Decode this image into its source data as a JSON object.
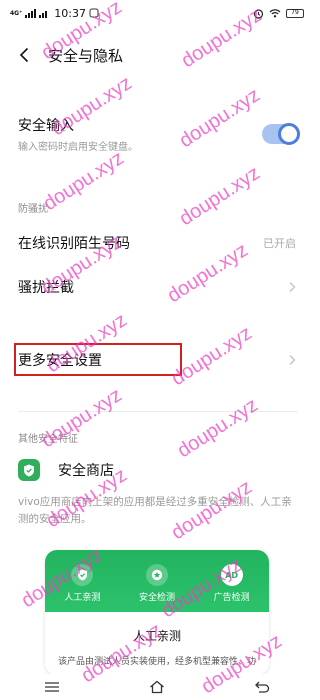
{
  "status_bar": {
    "network": "4G⁺",
    "time": "10:37",
    "battery": "79"
  },
  "header": {
    "title": "安全与隐私"
  },
  "rows": {
    "secure_input": {
      "title": "安全输入",
      "subtitle": "输入密码时启用安全键盘。",
      "toggle_on": true
    },
    "section_anti_harass": "防骚扰",
    "stranger_id": {
      "title": "在线识别陌生号码",
      "status": "已开启"
    },
    "harass_block": {
      "title": "骚扰拦截"
    },
    "more_security": {
      "title": "更多安全设置"
    }
  },
  "other_features": {
    "label": "其他安全特征",
    "store": {
      "title": "安全商店"
    },
    "description": "vivo应用商店内上架的应用都是经过多重安全检测、人工亲测的安全应用。"
  },
  "promo_card": {
    "features": [
      {
        "icon": "shield-check-icon",
        "label": "人工亲测"
      },
      {
        "icon": "star-badge-icon",
        "label": "安全检测"
      },
      {
        "icon": "ad-icon",
        "label": "广告检测",
        "icon_text": "AD"
      }
    ],
    "title": "人工亲测",
    "description": "该产品由测试人员实装使用，经多机型兼容性、功"
  },
  "watermark": "doupu.xyz",
  "colors": {
    "accent": "#4a7fe0",
    "green": "#2fae5b",
    "highlight": "#d21f1f",
    "watermark": "#ee3cc4"
  }
}
